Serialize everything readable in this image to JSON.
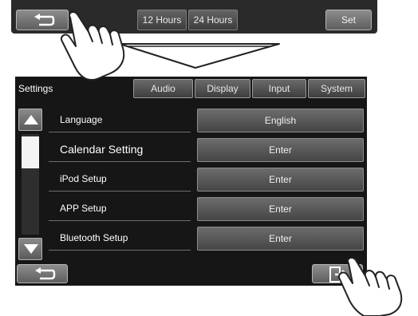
{
  "clock_panel": {
    "hours_12_label": "12 Hours",
    "hours_24_label": "24 Hours",
    "set_label": "Set"
  },
  "settings": {
    "title": "Settings",
    "tabs": [
      {
        "label": "Audio"
      },
      {
        "label": "Display"
      },
      {
        "label": "Input"
      },
      {
        "label": "System"
      }
    ],
    "rows": [
      {
        "label": "Language",
        "value": "English"
      },
      {
        "label": "Calendar Setting",
        "value": "Enter"
      },
      {
        "label": "iPod Setup",
        "value": "Enter"
      },
      {
        "label": "APP Setup",
        "value": "Enter"
      },
      {
        "label": "Bluetooth Setup",
        "value": "Enter"
      }
    ]
  },
  "icons": {
    "back": "back-arrow-icon",
    "exit": "exit-icon",
    "scroll_up": "triangle-up-icon",
    "scroll_down": "triangle-down-icon",
    "hand": "pointing-hand-icon"
  },
  "colors": {
    "screen_bg": "#161616",
    "button_light": "#8d8d8d",
    "button_dark": "#5e5e5e"
  }
}
